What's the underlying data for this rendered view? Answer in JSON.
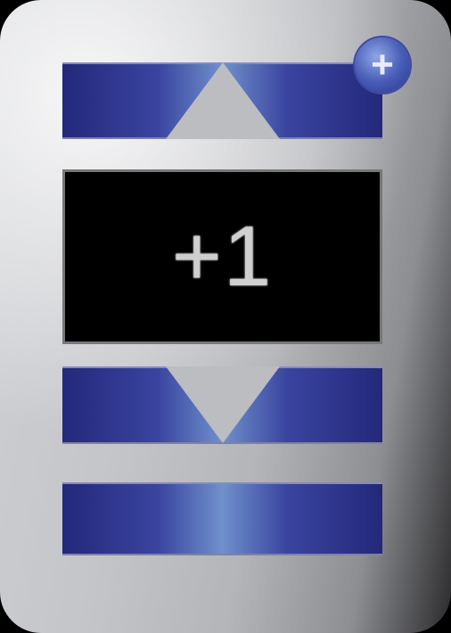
{
  "stepper": {
    "value": "+1",
    "add_badge_icon": "+"
  },
  "colors": {
    "panel": "#c4c5c9",
    "bar_dark": "#23287a",
    "bar_light": "#6f90cc",
    "display_bg": "#000000",
    "display_text": "#cfcfcf",
    "badge": "#4a5fb8"
  },
  "icons": {
    "increment": "triangle-up-icon",
    "decrement": "triangle-down-icon",
    "add": "plus-icon"
  }
}
